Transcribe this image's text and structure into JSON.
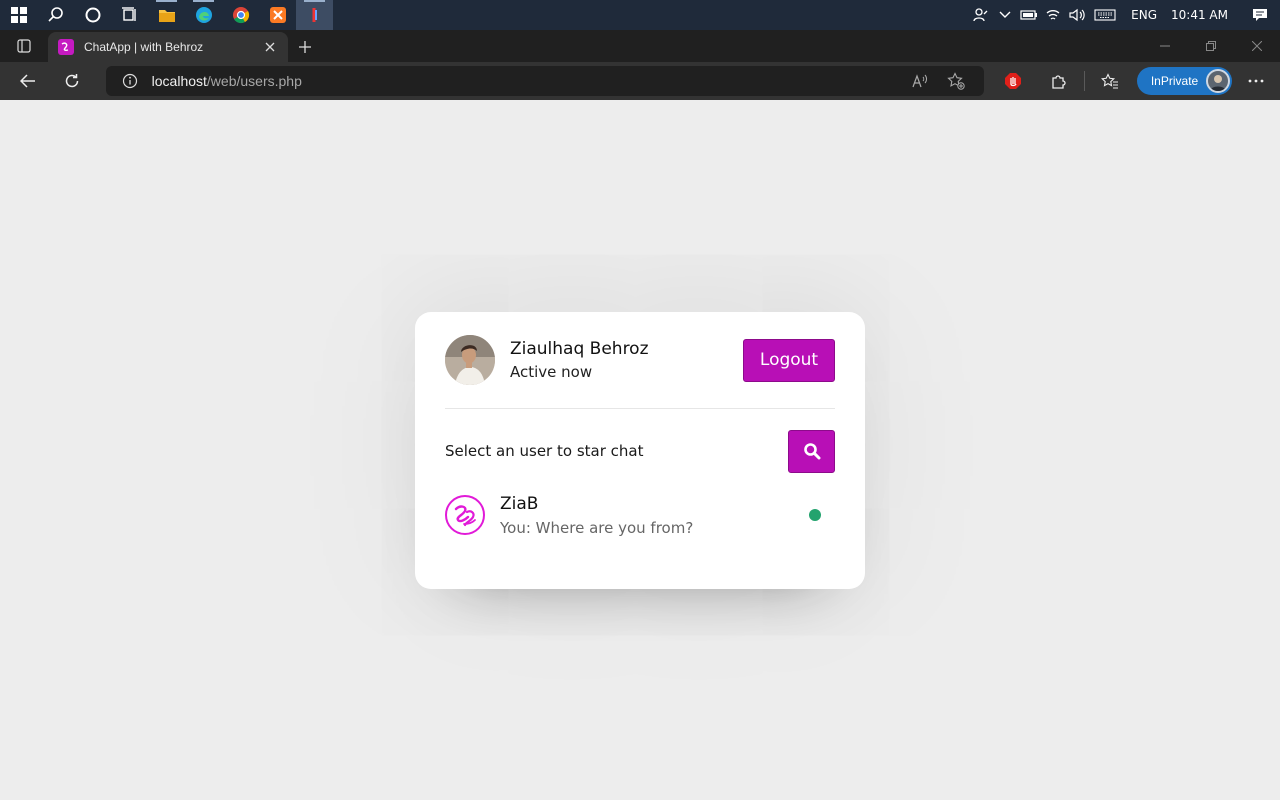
{
  "taskbar": {
    "language": "ENG",
    "time": "10:41 AM"
  },
  "browser": {
    "tab_title": "ChatApp | with Behroz",
    "url_host": "localhost",
    "url_path": "/web/users.php",
    "inprivate_label": "InPrivate"
  },
  "chat": {
    "current_user": {
      "name": "Ziaulhaq Behroz",
      "status": "Active now"
    },
    "logout_label": "Logout",
    "search_text": "Select an user to star chat",
    "users": [
      {
        "name": "ZiaB",
        "last_message": "You: Where are you from?",
        "status": "online"
      }
    ]
  },
  "colors": {
    "accent": "#b80fb6",
    "online": "#23a36e",
    "page_bg": "#ededed"
  }
}
